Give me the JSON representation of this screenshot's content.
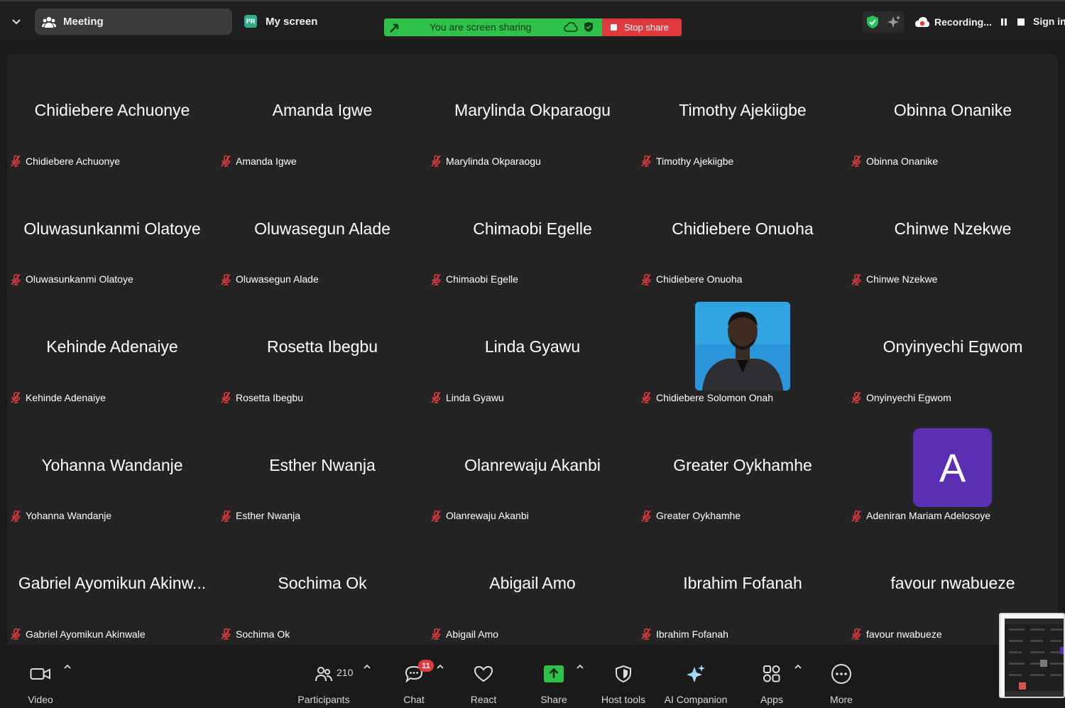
{
  "topbar": {
    "meeting_tab": "Meeting",
    "screen_tab": "My screen",
    "screen_tab_badge": "PR",
    "share_status": "You are screen sharing",
    "stop_share": "Stop share",
    "recording": "Recording...",
    "sign_in": "Sign in"
  },
  "participants": [
    {
      "big": "Chidiebere Achuonye",
      "name": "Chidiebere Achuonye"
    },
    {
      "big": "Amanda Igwe",
      "name": "Amanda Igwe"
    },
    {
      "big": "Marylinda Okparaogu",
      "name": "Marylinda Okparaogu"
    },
    {
      "big": "Timothy Ajekiigbe",
      "name": "Timothy Ajekiigbe"
    },
    {
      "big": "Obinna Onanike",
      "name": "Obinna Onanike"
    },
    {
      "big": "Oluwasunkanmi Olatoye",
      "name": "Oluwasunkanmi Olatoye"
    },
    {
      "big": "Oluwasegun Alade",
      "name": "Oluwasegun Alade"
    },
    {
      "big": "Chimaobi Egelle",
      "name": "Chimaobi Egelle"
    },
    {
      "big": "Chidiebere Onuoha",
      "name": "Chidiebere Onuoha"
    },
    {
      "big": "Chinwe Nzekwe",
      "name": "Chinwe Nzekwe"
    },
    {
      "big": "Kehinde Adenaiye",
      "name": "Kehinde Adenaiye"
    },
    {
      "big": "Rosetta Ibegbu",
      "name": "Rosetta Ibegbu"
    },
    {
      "big": "Linda Gyawu",
      "name": "Linda Gyawu"
    },
    {
      "big": "",
      "name": "Chidiebere Solomon Onah"
    },
    {
      "big": "Onyinyechi Egwom",
      "name": "Onyinyechi Egwom"
    },
    {
      "big": "Yohanna Wandanje",
      "name": "Yohanna Wandanje"
    },
    {
      "big": "Esther Nwanja",
      "name": "Esther Nwanja"
    },
    {
      "big": "Olanrewaju Akanbi",
      "name": "Olanrewaju Akanbi"
    },
    {
      "big": "Greater Oykhamhe",
      "name": "Greater Oykhamhe"
    },
    {
      "big": "",
      "name": "Adeniran Mariam Adelosoye"
    },
    {
      "big": "Gabriel Ayomikun Akinw...",
      "name": "Gabriel Ayomikun Akinwale"
    },
    {
      "big": "Sochima Ok",
      "name": "Sochima Ok"
    },
    {
      "big": "Abigail Amo",
      "name": "Abigail Amo"
    },
    {
      "big": "Ibrahim Fofanah",
      "name": "Ibrahim Fofanah"
    },
    {
      "big": "favour nwabueze",
      "name": "favour nwabueze"
    }
  ],
  "avatar_letter": "A",
  "toolbar": {
    "video": "Video",
    "participants": "Participants",
    "participants_count": "210",
    "chat": "Chat",
    "chat_badge": "11",
    "react": "React",
    "share": "Share",
    "host_tools": "Host tools",
    "ai_companion": "AI Companion",
    "apps": "Apps",
    "more": "More"
  },
  "colors": {
    "share_green": "#2fc24b",
    "stop_red": "#e0393e",
    "avatar_purple": "#5a2fb4",
    "muted_red": "#e0393e"
  }
}
